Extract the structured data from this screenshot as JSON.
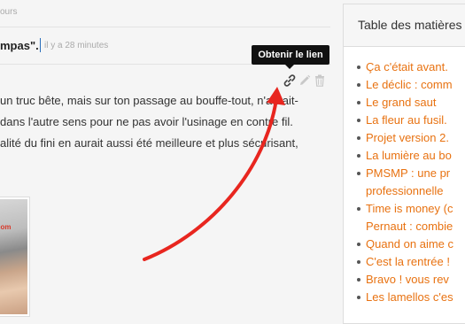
{
  "header_meta": "ours",
  "post": {
    "title": "mpas\".",
    "time": "il y a 28 minutes",
    "lines": [
      "un truc bête, mais sur ton passage au bouffe-tout, n'aurait-",
      "dans l'autre sens pour ne pas avoir l'usinage en contre fil.",
      "alité du fini en aurait aussi été meilleure et plus sécurisant,"
    ],
    "thumbnail_caption": "com"
  },
  "tooltip": {
    "text": "Obtenir le lien"
  },
  "icons": {
    "link": "link-icon",
    "edit": "pencil-icon",
    "delete": "trash-icon"
  },
  "colors": {
    "accent": "#e87211",
    "annotation_arrow": "#e8261f",
    "tooltip_bg": "#111111"
  },
  "sidebar": {
    "title": "Table des matières",
    "items": [
      "Ça c'était avant.",
      "Le déclic : comm",
      "Le grand saut",
      "La fleur au fusil.",
      "Projet version 2.",
      "La lumière au bo",
      "PMSMP : une pr",
      "professionnelle",
      "Time is money (c",
      "Pernaut : combie",
      "Quand on aime c",
      "C'est la rentrée !",
      "Bravo ! vous rev",
      "Les lamellos c'es"
    ]
  }
}
